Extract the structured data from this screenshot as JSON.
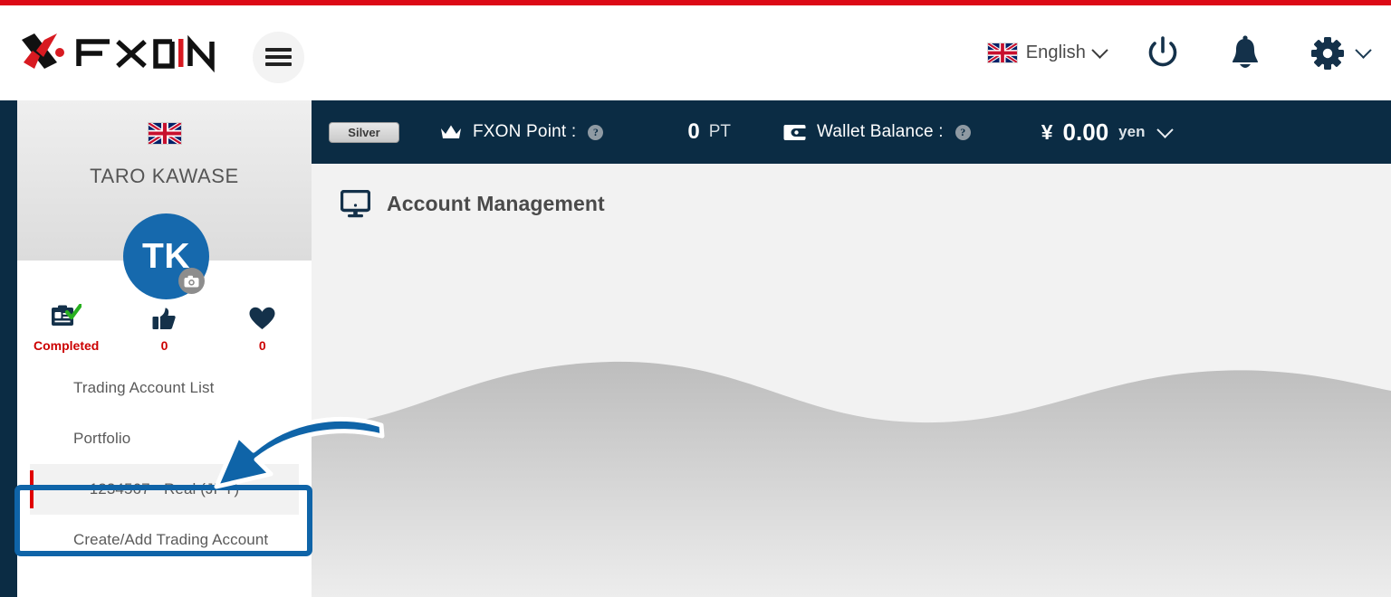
{
  "header": {
    "logo_text": "FXON",
    "menu_button": "hamburger-menu",
    "language": {
      "label": "English",
      "flag": "uk-flag"
    },
    "icons": {
      "power": "power-icon",
      "notifications": "bell-icon",
      "settings": "gear-icon"
    }
  },
  "statusbar": {
    "rank_badge": "Silver",
    "fxon_point_label": "FXON Point :",
    "fxon_point_value": "0",
    "fxon_point_unit": "PT",
    "wallet_label": "Wallet Balance :",
    "wallet_currency_symbol": "¥",
    "wallet_value": "0.00",
    "wallet_unit": "yen",
    "help_glyph": "?"
  },
  "sidebar": {
    "user_name": "TARO KAWASE",
    "avatar_initials": "TK",
    "flag": "uk-flag",
    "stats": [
      {
        "icon": "id-card-verified-icon",
        "label": "Completed"
      },
      {
        "icon": "thumbs-up-icon",
        "label": "0"
      },
      {
        "icon": "heart-icon",
        "label": "0"
      }
    ],
    "nav": [
      {
        "label": "Trading Account List",
        "type": "item"
      },
      {
        "label": "Portfolio",
        "type": "collapsible"
      },
      {
        "label": "1234567 - Real (JPY)",
        "type": "sub"
      },
      {
        "label": "Create/Add Trading Account",
        "type": "item"
      }
    ]
  },
  "main": {
    "page_title": "Account Management",
    "page_icon": "monitor-icon"
  },
  "colors": {
    "accent_red": "#dc0a16",
    "navy": "#0b2c44",
    "avatar_blue": "#1669ad",
    "annotation_blue": "#0f64a8",
    "marker_red": "#e00000",
    "stat_red": "#cc0000"
  }
}
